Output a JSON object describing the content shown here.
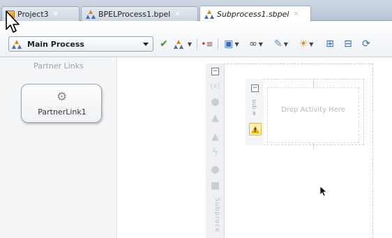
{
  "tabs": [
    {
      "label": "Project3",
      "active": false
    },
    {
      "label": "BPELProcess1.bpel",
      "active": false
    },
    {
      "label": "Subprocess1.sbpel",
      "active": true
    }
  ],
  "toolbar": {
    "process_select_value": "Main Process",
    "validate_icon": "checkmark-icon",
    "tools": [
      "process-icon",
      "align-icon",
      "expression-icon",
      "binoculars-icon",
      "deploy-icon",
      "sensor-icon",
      "expand-all-icon",
      "collapse-all-icon",
      "refresh-icon"
    ]
  },
  "partner_panel": {
    "title": "Partner Links",
    "partner_link_label": "PartnerLink1"
  },
  "canvas": {
    "palette_vertical_label": "Subproce",
    "inner_vertical_label": "sub ≡",
    "drop_zone_text": "Drop Activity Here"
  },
  "colors": {
    "active_tab_bg": "#ffffff",
    "tabbar_bg": "#c4cedb",
    "warning": "#e6b100",
    "validate_green": "#2e9a2a"
  }
}
